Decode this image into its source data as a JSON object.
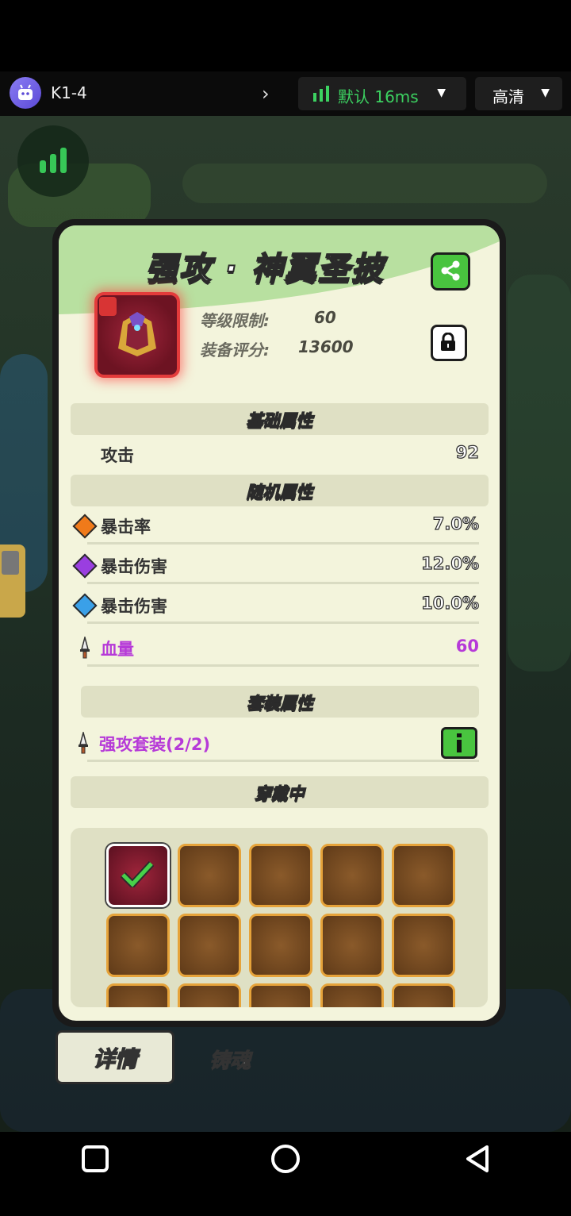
{
  "status_bar": {
    "room_name": "K1-4",
    "network_label": "默认 16ms",
    "quality_label": "高清"
  },
  "item": {
    "name": "强攻 · 神翼圣披",
    "level_label": "等级限制:",
    "level_value": "60",
    "score_label": "装备评分:",
    "score_value": "13600"
  },
  "sections": {
    "base": "基础属性",
    "random": "随机属性",
    "set": "套装属性",
    "equipped": "穿戴中"
  },
  "base_attrs": [
    {
      "label": "攻击",
      "value": "92"
    }
  ],
  "random_attrs": [
    {
      "label": "暴击率",
      "value": "7.0%",
      "gem_color": "#f07a1a"
    },
    {
      "label": "暴击伤害",
      "value": "12.0%",
      "gem_color": "#9a3ee0"
    },
    {
      "label": "暴击伤害",
      "value": "10.0%",
      "gem_color": "#3aa0e8"
    },
    {
      "label": "血量",
      "value": "60",
      "text_color": "#b63ad8"
    }
  ],
  "set_attr": {
    "label": "强攻套装(2/2)",
    "text_color": "#b63ad8"
  },
  "tabs": {
    "details": "详情",
    "soul": "铸魂"
  },
  "colors": {
    "accent_green": "#49c43f",
    "panel_bg": "#f3f4dc",
    "section_bg": "#dfe0c4"
  }
}
